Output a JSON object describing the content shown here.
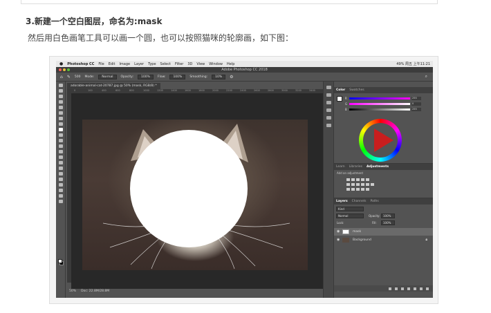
{
  "article": {
    "heading": "3.新建一个空白图层，命名为:mask",
    "body": "然后用白色画笔工具可以画一个圆，也可以按照猫咪的轮廓画，如下图："
  },
  "mac_menu": {
    "apple": "",
    "app": "Photoshop CC",
    "items": [
      "File",
      "Edit",
      "Image",
      "Layer",
      "Type",
      "Select",
      "Filter",
      "3D",
      "View",
      "Window",
      "Help"
    ],
    "status": "49%  周五 上午11:21"
  },
  "window": {
    "title": "Adobe Photoshop CC 2018"
  },
  "options_bar": {
    "size": "500",
    "mode_label": "Mode:",
    "mode_value": "Normal",
    "opacity_label": "Opacity:",
    "opacity_value": "100%",
    "flow_label": "Flow:",
    "flow_value": "100%",
    "smoothing_label": "Smoothing:",
    "smoothing_value": "10%"
  },
  "document": {
    "tab": "adorable-animal-cat-20787.jpg @ 50% (mask, RGB/8) *",
    "ruler_ticks": [
      "0",
      "100",
      "400",
      "600",
      "800",
      "1000",
      "1200",
      "1400",
      "1600",
      "1800",
      "2000",
      "2200",
      "2400",
      "2600",
      "2800",
      "3000",
      "3200",
      "3400"
    ],
    "zoom": "50%",
    "doc_info": "Doc: 22.8M/28.8M"
  },
  "color_panel": {
    "tabs": [
      "Color",
      "Swatches"
    ],
    "sliders": [
      {
        "label": "R",
        "value": "255"
      },
      {
        "label": "G",
        "value": "0"
      },
      {
        "label": "B",
        "value": "255"
      }
    ],
    "fg_color": "#ffffff",
    "bg_color": "#000000"
  },
  "adjustments_panel": {
    "tabs": [
      "Learn",
      "Libraries",
      "Adjustments"
    ],
    "hint": "Add an adjustment"
  },
  "layers_panel": {
    "tabs": [
      "Layers",
      "Channels",
      "Paths"
    ],
    "kind": "Kind",
    "blend": "Normal",
    "opacity_label": "Opacity:",
    "opacity_value": "100%",
    "lock_label": "Lock:",
    "fill_label": "Fill:",
    "fill_value": "100%",
    "layers": [
      {
        "name": "mask",
        "selected": true
      },
      {
        "name": "Background",
        "selected": false
      }
    ]
  }
}
